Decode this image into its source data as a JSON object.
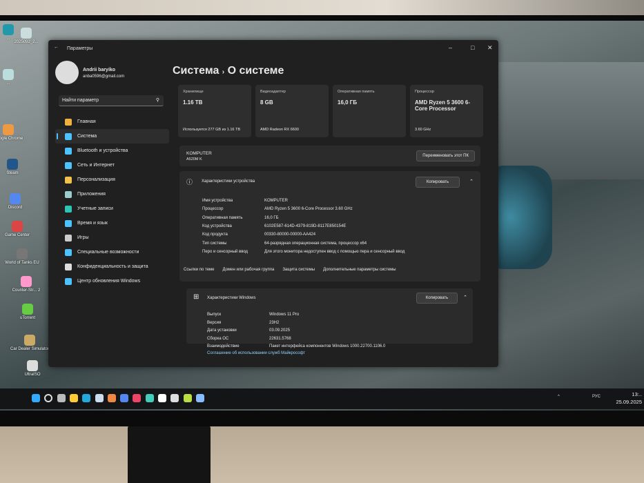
{
  "desktop": {
    "icons": [
      "2025092_2...",
      "...",
      "...",
      "Google Chrome",
      "Steam",
      "Discord",
      "Game Center",
      "World of Tanks EU",
      "Counter-Str... 2",
      "uTorrent",
      "Car Dealer Simulator",
      "UltraISO"
    ]
  },
  "window": {
    "title": "Параметры",
    "minimize": "–",
    "maximize": "□",
    "close": "✕"
  },
  "user": {
    "name": "Andrii baryiko",
    "email": "anba0596@gmail.com"
  },
  "search": {
    "placeholder": "Найти параметр"
  },
  "nav": [
    {
      "label": "Главная",
      "color": "#f0b040"
    },
    {
      "label": "Система",
      "color": "#4cc2ff"
    },
    {
      "label": "Bluetooth и устройства",
      "color": "#4cc2ff"
    },
    {
      "label": "Сеть и Интернет",
      "color": "#4cc2ff"
    },
    {
      "label": "Персонализация",
      "color": "#f2c04d"
    },
    {
      "label": "Приложения",
      "color": "#9cc"
    },
    {
      "label": "Учетные записи",
      "color": "#2ec4b6"
    },
    {
      "label": "Время и язык",
      "color": "#4cc2ff"
    },
    {
      "label": "Игры",
      "color": "#ccc"
    },
    {
      "label": "Специальные возможности",
      "color": "#4cc2ff"
    },
    {
      "label": "Конфиденциальность и защита",
      "color": "#ddd"
    },
    {
      "label": "Центр обновления Windows",
      "color": "#4cc2ff"
    }
  ],
  "breadcrumb": {
    "parent": "Система",
    "sep": "›",
    "current": "О системе"
  },
  "cards": [
    {
      "title": "Хранилище",
      "value": "1.16 TB",
      "sub": "Используется 277 GB из 1.16 TB"
    },
    {
      "title": "Видеоадаптер",
      "value": "8 GB",
      "sub": "AMD Radeon RX 6600"
    },
    {
      "title": "Оперативная память",
      "value": "16,0 ГБ",
      "sub": ""
    },
    {
      "title": "Процессор",
      "value": "AMD Ryzen 5 3600 6-Core Processor",
      "sub": "3.60 GHz"
    }
  ],
  "pc": {
    "name": "KOMPUTER",
    "model": "A520M K",
    "rename": "Переименовать этот ПК"
  },
  "device": {
    "title": "Характеристики устройства",
    "copy": "Копировать",
    "rows": [
      [
        "Имя устройства",
        "KOMPUTER"
      ],
      [
        "Процессор",
        "AMD Ryzen 5 3600 6-Core Processor       3.60 GHz"
      ],
      [
        "Оперативная память",
        "16,0 ГБ"
      ],
      [
        "Код устройства",
        "6102E587-614D-4379-819D-8117E850154E"
      ],
      [
        "Код продукта",
        "00330-80000-00000-AA424"
      ],
      [
        "Тип системы",
        "64-разрядная операционная система, процессор x64"
      ],
      [
        "Перо и сенсорный ввод",
        "Для этого монитора недоступен ввод с помощью пера и сенсорный ввод"
      ]
    ]
  },
  "links": {
    "label": "Ссылки по теме",
    "items": [
      "Домен или рабочая группа",
      "Защита системы",
      "Дополнительные параметры системы"
    ]
  },
  "windows": {
    "title": "Характеристики Windows",
    "copy": "Копировать",
    "rows": [
      [
        "Выпуск",
        "Windows 11 Pro"
      ],
      [
        "Версия",
        "23H2"
      ],
      [
        "Дата установки",
        "03.09.2025"
      ],
      [
        "Сборка ОС",
        "22631.5768"
      ],
      [
        "Взаимодействие",
        "Пакет интерфейса компонентов Windows 1000.22700.1106.0"
      ]
    ],
    "agreement": "Соглашение об использовании служб Майкрософт"
  },
  "tray": {
    "lang": "РУС",
    "time": "13:..",
    "date": "25.09.2025"
  }
}
